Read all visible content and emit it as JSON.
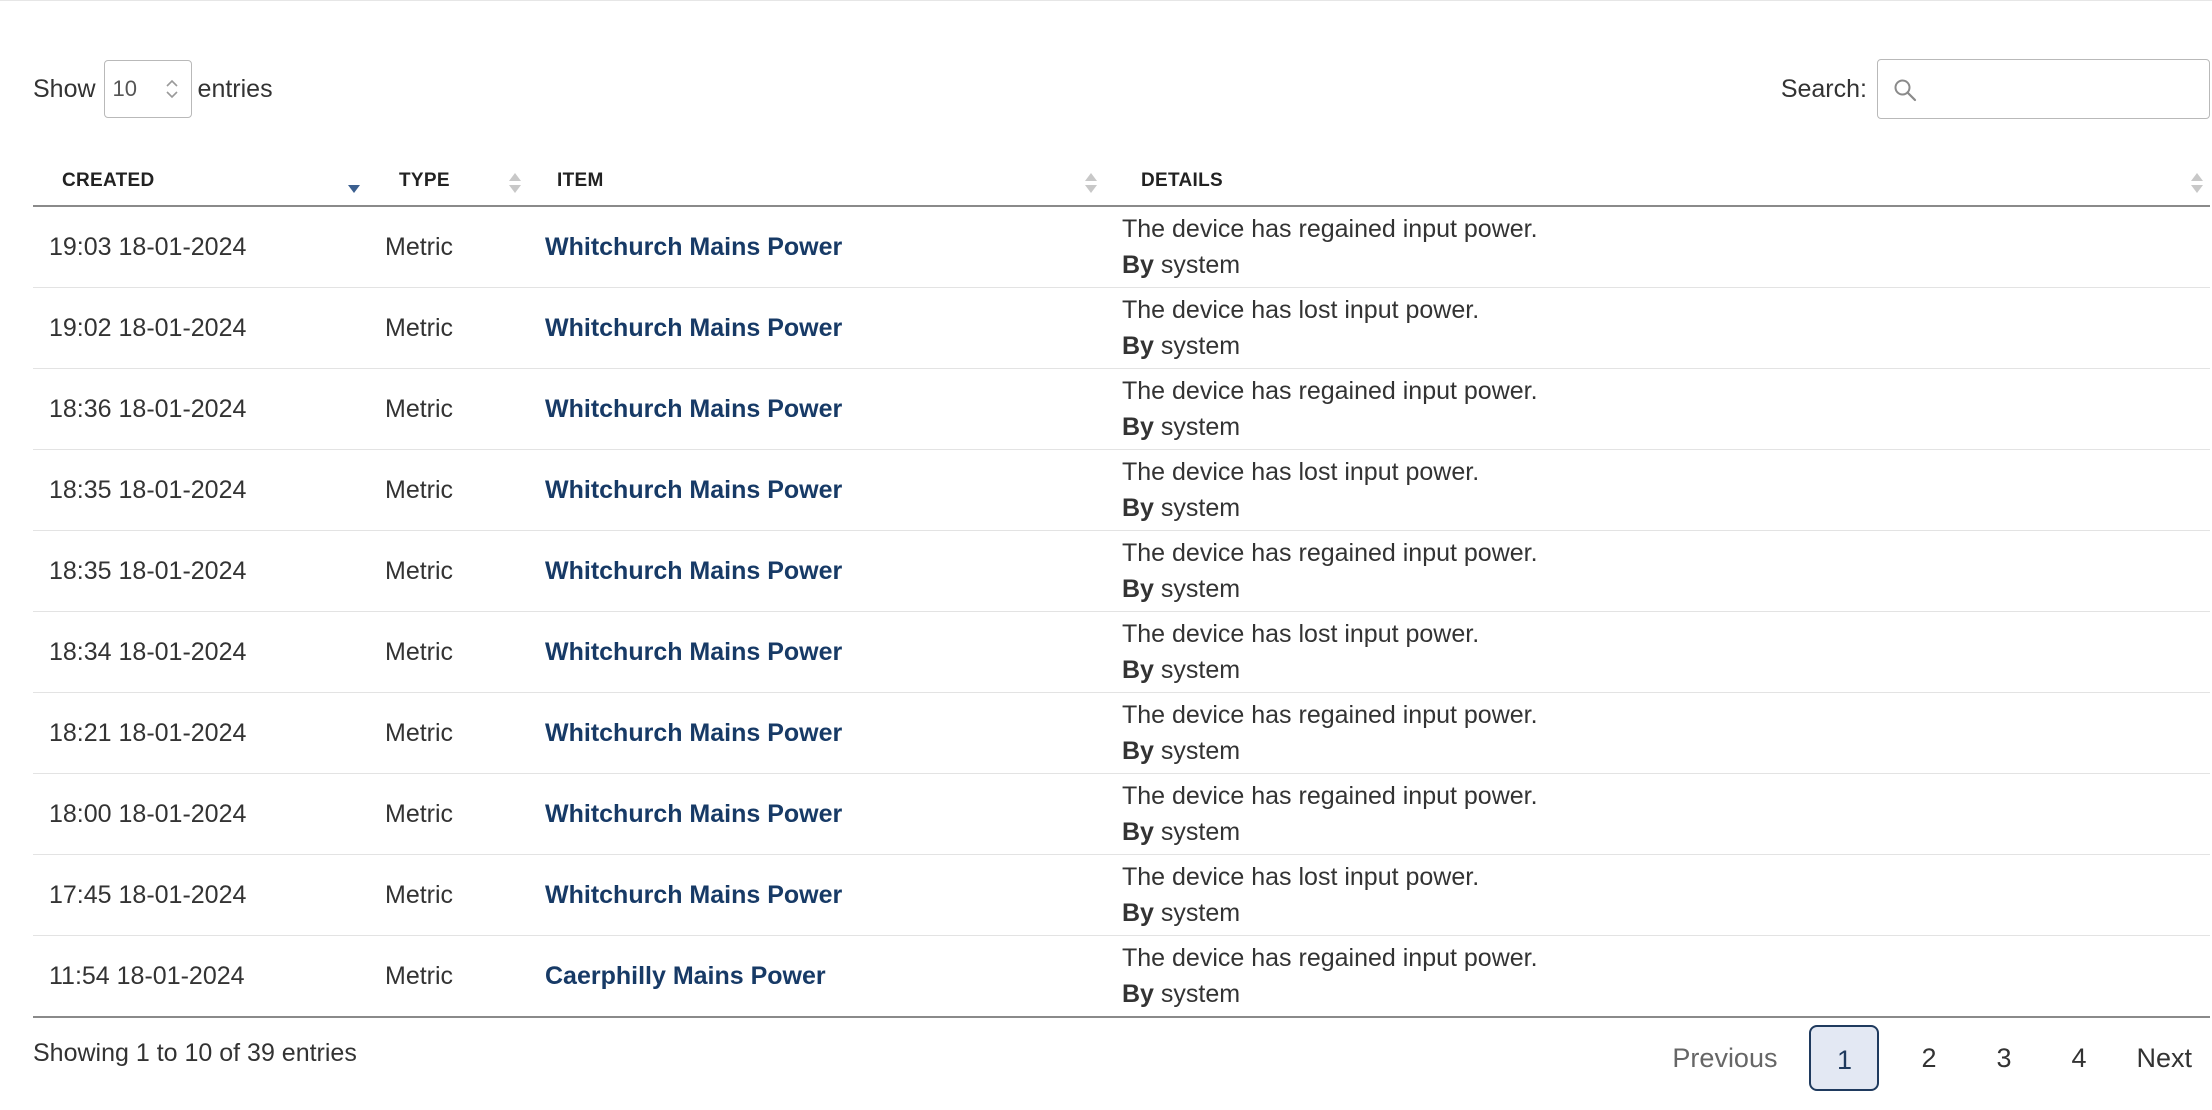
{
  "length_control": {
    "show_label": "Show",
    "selected": "10",
    "entries_label": "entries"
  },
  "search": {
    "label": "Search:",
    "value": ""
  },
  "table": {
    "columns": [
      "CREATED",
      "TYPE",
      "ITEM",
      "DETAILS"
    ],
    "sorted_column": "CREATED",
    "sort_direction": "descending",
    "rows": [
      {
        "created": "19:03 18-01-2024",
        "type": "Metric",
        "item": "Whitchurch Mains Power",
        "details": "The device has regained input power.",
        "by_label": "By",
        "by": "system"
      },
      {
        "created": "19:02 18-01-2024",
        "type": "Metric",
        "item": "Whitchurch Mains Power",
        "details": "The device has lost input power.",
        "by_label": "By",
        "by": "system"
      },
      {
        "created": "18:36 18-01-2024",
        "type": "Metric",
        "item": "Whitchurch Mains Power",
        "details": "The device has regained input power.",
        "by_label": "By",
        "by": "system"
      },
      {
        "created": "18:35 18-01-2024",
        "type": "Metric",
        "item": "Whitchurch Mains Power",
        "details": "The device has lost input power.",
        "by_label": "By",
        "by": "system"
      },
      {
        "created": "18:35 18-01-2024",
        "type": "Metric",
        "item": "Whitchurch Mains Power",
        "details": "The device has regained input power.",
        "by_label": "By",
        "by": "system"
      },
      {
        "created": "18:34 18-01-2024",
        "type": "Metric",
        "item": "Whitchurch Mains Power",
        "details": "The device has lost input power.",
        "by_label": "By",
        "by": "system"
      },
      {
        "created": "18:21 18-01-2024",
        "type": "Metric",
        "item": "Whitchurch Mains Power",
        "details": "The device has regained input power.",
        "by_label": "By",
        "by": "system"
      },
      {
        "created": "18:00 18-01-2024",
        "type": "Metric",
        "item": "Whitchurch Mains Power",
        "details": "The device has regained input power.",
        "by_label": "By",
        "by": "system"
      },
      {
        "created": "17:45 18-01-2024",
        "type": "Metric",
        "item": "Whitchurch Mains Power",
        "details": "The device has lost input power.",
        "by_label": "By",
        "by": "system"
      },
      {
        "created": "11:54 18-01-2024",
        "type": "Metric",
        "item": "Caerphilly Mains Power",
        "details": "The device has regained input power.",
        "by_label": "By",
        "by": "system"
      }
    ]
  },
  "footer": {
    "info": "Showing 1 to 10 of 39 entries"
  },
  "pagination": {
    "previous": "Previous",
    "pages": [
      "1",
      "2",
      "3",
      "4"
    ],
    "current": "1",
    "next": "Next"
  },
  "colors": {
    "link": "#173a66",
    "current_page_bg": "#e3e8f3",
    "current_page_border": "#1f3a5e",
    "sort_active": "#3b5f8f",
    "sort_inactive": "#c8c8c8"
  },
  "icons": {
    "search": "magnifier-icon",
    "select": "spinner-arrows-icon",
    "sort": "sort-arrows-icon"
  }
}
